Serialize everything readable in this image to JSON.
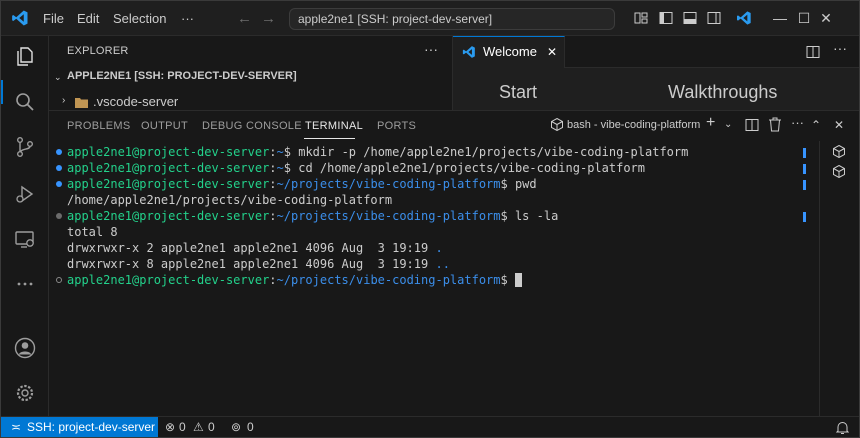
{
  "titlebar": {
    "menu": [
      "File",
      "Edit",
      "Selection",
      "···"
    ],
    "command_center": "apple2ne1 [SSH: project-dev-server]",
    "window_controls": {
      "minimize": "—",
      "maximize": "☐",
      "close": "✕"
    }
  },
  "sidebar": {
    "title": "EXPLORER",
    "more": "···",
    "section": "APPLE2NE1 [SSH: PROJECT-DEV-SERVER]",
    "items": [
      {
        "label": ".vscode-server"
      }
    ]
  },
  "editor": {
    "tab_label": "Welcome",
    "welcome_start": "Start",
    "welcome_walkthroughs": "Walkthroughs"
  },
  "panel": {
    "tabs": [
      "PROBLEMS",
      "OUTPUT",
      "DEBUG CONSOLE",
      "TERMINAL",
      "PORTS"
    ],
    "active_tab": "TERMINAL",
    "terminal_name": "bash - vibe-coding-platform"
  },
  "terminal": {
    "user_host": "apple2ne1@project-dev-server",
    "lines": [
      {
        "path": "~",
        "cmd": " mkdir -p /home/apple2ne1/projects/vibe-coding-platform"
      },
      {
        "path": "~",
        "cmd": " cd /home/apple2ne1/projects/vibe-coding-platform"
      },
      {
        "path": "~/projects/vibe-coding-platform",
        "cmd": " pwd"
      },
      {
        "output": "/home/apple2ne1/projects/vibe-coding-platform"
      },
      {
        "path": "~/projects/vibe-coding-platform",
        "cmd": " ls -la"
      },
      {
        "output": "total 8"
      },
      {
        "output": "drwxrwxr-x 2 apple2ne1 apple2ne1 4096 Aug  3 19:19 ",
        "dir": "."
      },
      {
        "output": "drwxrwxr-x 8 apple2ne1 apple2ne1 4096 Aug  3 19:19 ",
        "dir": ".."
      },
      {
        "path": "~/projects/vibe-coding-platform",
        "cmd": " "
      }
    ]
  },
  "statusbar": {
    "remote": "SSH: project-dev-server",
    "errors": "0",
    "warnings": "0",
    "ports": "0"
  },
  "colors": {
    "accent": "#0078d4",
    "prompt_user": "#23d18b",
    "prompt_path": "#3b8eea"
  }
}
